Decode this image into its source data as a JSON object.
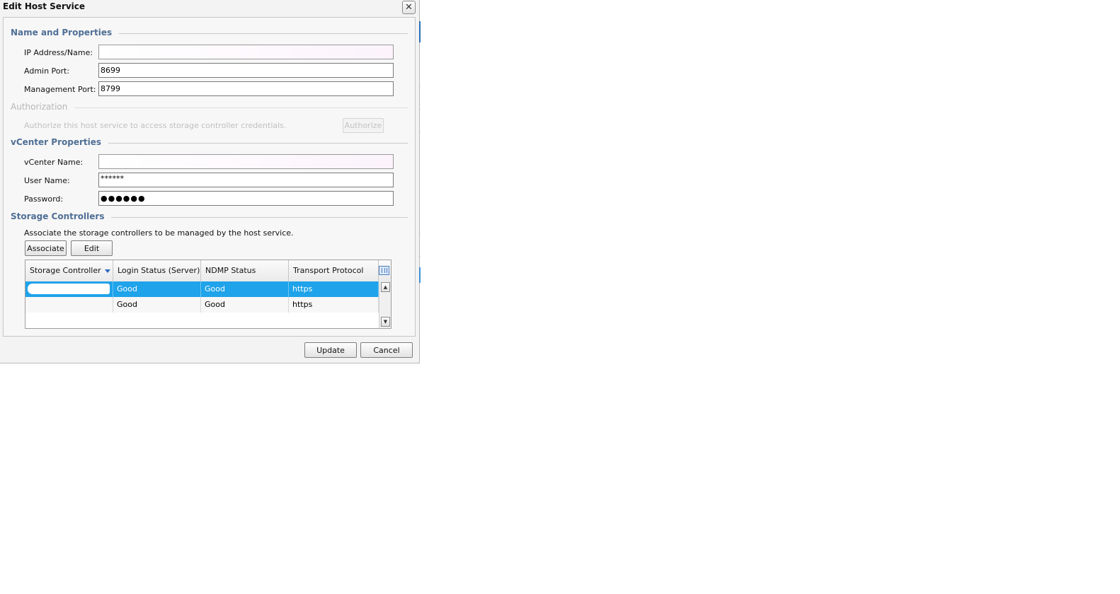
{
  "dialog": {
    "title": "Edit Host Service",
    "close_glyph": "✕"
  },
  "sections": {
    "name_props": "Name and Properties",
    "authorization": "Authorization",
    "vcenter": "vCenter Properties",
    "storage": "Storage Controllers"
  },
  "name_props": {
    "ip_label": "IP Address/Name:",
    "ip_value": "",
    "admin_port_label": "Admin Port:",
    "admin_port_value": "8699",
    "mgmt_port_label": "Management Port:",
    "mgmt_port_value": "8799"
  },
  "authorization": {
    "hint": "Authorize this host service to access storage controller credentials.",
    "button": "Authorize"
  },
  "vcenter": {
    "name_label": "vCenter Name:",
    "name_value": "",
    "user_label": "User Name:",
    "user_value": "******",
    "password_label": "Password:",
    "password_value": "●●●●●●"
  },
  "storage": {
    "description": "Associate the storage controllers to be managed by the host service.",
    "associate_button": "Associate",
    "edit_button": "Edit",
    "columns": [
      "Storage Controller",
      "Login Status (Server)",
      "NDMP Status",
      "Transport Protocol"
    ],
    "rows": [
      {
        "controller": "",
        "login": "Good",
        "ndmp": "Good",
        "protocol": "https"
      },
      {
        "controller": "",
        "login": "Good",
        "ndmp": "Good",
        "protocol": "https"
      }
    ]
  },
  "footer": {
    "update": "Update",
    "cancel": "Cancel"
  },
  "colors": {
    "section_title": "#4f6f95",
    "selection": "#1fa3ea"
  }
}
